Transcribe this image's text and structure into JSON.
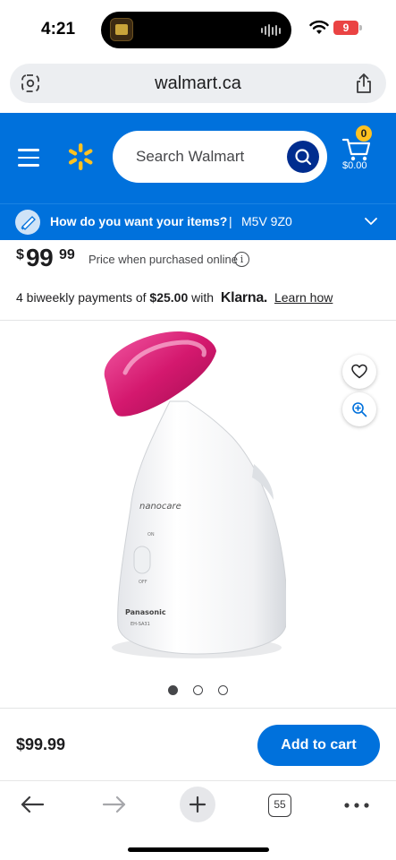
{
  "status_bar": {
    "time": "4:21",
    "battery": "9"
  },
  "browser": {
    "url": "walmart.ca",
    "tab_count": "55"
  },
  "header": {
    "search_placeholder": "Search Walmart",
    "cart_count": "0",
    "cart_total": "$0.00"
  },
  "delivery": {
    "question": "How do you want your items?",
    "separator": "|",
    "postal_code": "M5V 9Z0"
  },
  "price": {
    "currency": "$",
    "whole": "99",
    "cents": "99",
    "note": "Price when purchased online",
    "info_glyph": "i"
  },
  "financing": {
    "prefix": "4 biweekly payments of ",
    "amount": "$25.00",
    "with": " with ",
    "brand": "Klarna.",
    "link": "Learn how"
  },
  "product": {
    "brand_text": "nanocare",
    "maker_text": "Panasonic",
    "model_text": "EH-SA31",
    "switch_on": "ON",
    "switch_off": "OFF",
    "image_count": 3,
    "active_image": 0
  },
  "footer": {
    "price": "$99.99",
    "add_to_cart": "Add to cart"
  },
  "colors": {
    "walmart_blue": "#0071dc",
    "spark_yellow": "#ffc220",
    "search_button": "#002d8f",
    "product_pink": "#d4186e"
  }
}
